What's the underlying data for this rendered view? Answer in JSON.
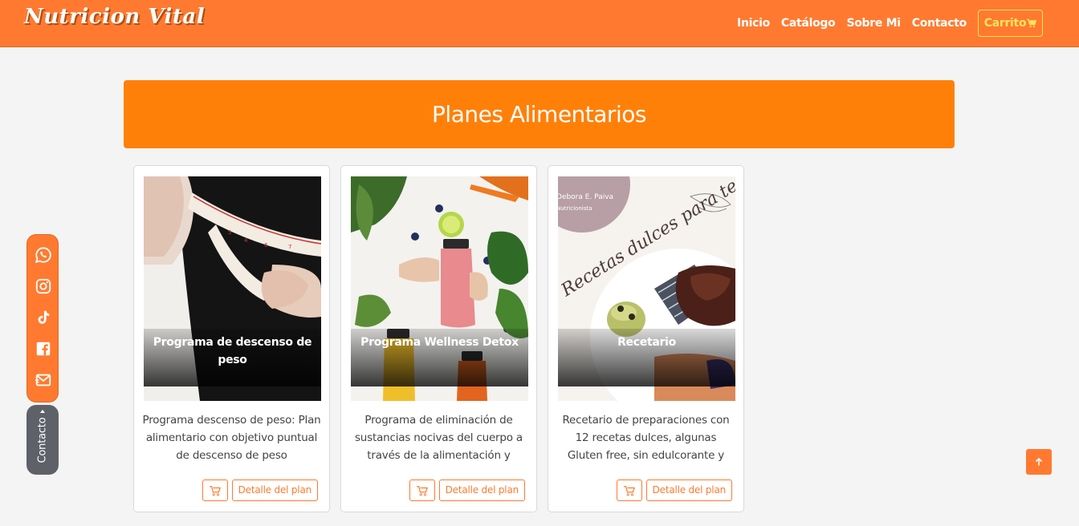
{
  "brand": "Nutricion Vital",
  "nav": {
    "links": [
      "Inicio",
      "Catálogo",
      "Sobre Mi",
      "Contacto"
    ],
    "cart_label": "Carrito"
  },
  "banner": {
    "title": "Planes Alimentarios"
  },
  "cards": [
    {
      "title": "Programa de descenso de peso",
      "text": "Programa descenso de peso: Plan alimentario con objetivo puntual de descenso de peso",
      "detail_label": "Detalle del plan"
    },
    {
      "title": "Programa Wellness Detox",
      "text": "Programa de eliminación de sustancias nocivas del cuerpo a través de la alimentación y",
      "detail_label": "Detalle del plan"
    },
    {
      "title": "Recetario",
      "text": "Recetario de preparaciones con 12 recetas dulces, algunas Gluten free, sin edulcorante y",
      "detail_label": "Detalle del plan"
    }
  ],
  "recetario_image": {
    "author": "Debora E. Paiva",
    "role": "Nutricionista",
    "script_title": "Recetas dulces para tentarte"
  },
  "social": {
    "icons": [
      "whatsapp-icon",
      "instagram-icon",
      "tiktok-icon",
      "facebook-icon",
      "email-icon"
    ],
    "contact_tab_label": "Contacto"
  },
  "colors": {
    "navbar": "#ff7a30",
    "banner": "#ff8008",
    "accent": "#ff7a30",
    "cart_border": "#ffe45a",
    "contact_tab": "#5f6168"
  }
}
